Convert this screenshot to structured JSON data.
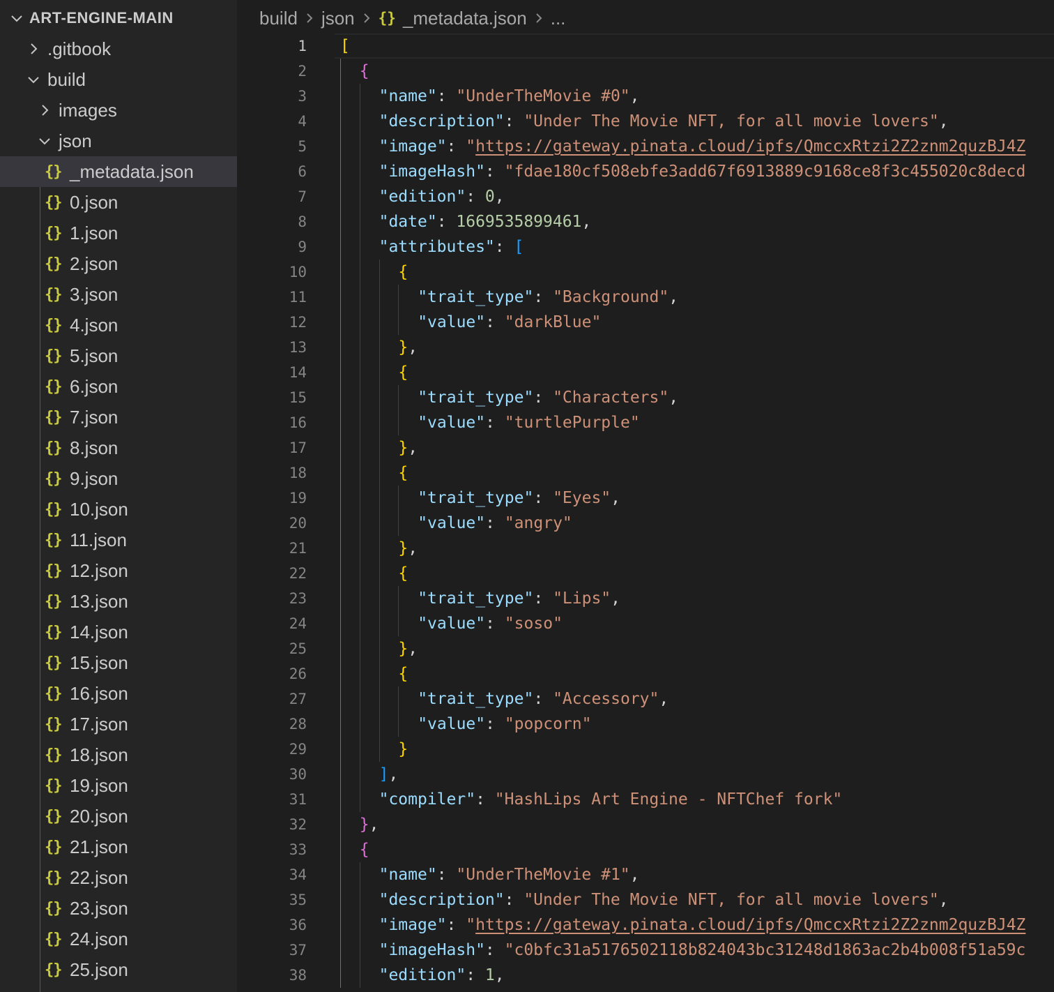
{
  "explorer": {
    "root_label": "ART-ENGINE-MAIN",
    "items": [
      {
        "label": ".gitbook",
        "type": "folder",
        "expanded": false,
        "depth": 1
      },
      {
        "label": "build",
        "type": "folder",
        "expanded": true,
        "depth": 1
      },
      {
        "label": "images",
        "type": "folder",
        "expanded": false,
        "depth": 2
      },
      {
        "label": "json",
        "type": "folder",
        "expanded": true,
        "depth": 2
      },
      {
        "label": "_metadata.json",
        "type": "file",
        "selected": true,
        "depth": 3
      },
      {
        "label": "0.json",
        "type": "file",
        "depth": 3
      },
      {
        "label": "1.json",
        "type": "file",
        "depth": 3
      },
      {
        "label": "2.json",
        "type": "file",
        "depth": 3
      },
      {
        "label": "3.json",
        "type": "file",
        "depth": 3
      },
      {
        "label": "4.json",
        "type": "file",
        "depth": 3
      },
      {
        "label": "5.json",
        "type": "file",
        "depth": 3
      },
      {
        "label": "6.json",
        "type": "file",
        "depth": 3
      },
      {
        "label": "7.json",
        "type": "file",
        "depth": 3
      },
      {
        "label": "8.json",
        "type": "file",
        "depth": 3
      },
      {
        "label": "9.json",
        "type": "file",
        "depth": 3
      },
      {
        "label": "10.json",
        "type": "file",
        "depth": 3
      },
      {
        "label": "11.json",
        "type": "file",
        "depth": 3
      },
      {
        "label": "12.json",
        "type": "file",
        "depth": 3
      },
      {
        "label": "13.json",
        "type": "file",
        "depth": 3
      },
      {
        "label": "14.json",
        "type": "file",
        "depth": 3
      },
      {
        "label": "15.json",
        "type": "file",
        "depth": 3
      },
      {
        "label": "16.json",
        "type": "file",
        "depth": 3
      },
      {
        "label": "17.json",
        "type": "file",
        "depth": 3
      },
      {
        "label": "18.json",
        "type": "file",
        "depth": 3
      },
      {
        "label": "19.json",
        "type": "file",
        "depth": 3
      },
      {
        "label": "20.json",
        "type": "file",
        "depth": 3
      },
      {
        "label": "21.json",
        "type": "file",
        "depth": 3
      },
      {
        "label": "22.json",
        "type": "file",
        "depth": 3
      },
      {
        "label": "23.json",
        "type": "file",
        "depth": 3
      },
      {
        "label": "24.json",
        "type": "file",
        "depth": 3
      },
      {
        "label": "25.json",
        "type": "file",
        "depth": 3
      }
    ],
    "file_icon_glyph": "{}"
  },
  "breadcrumb": {
    "items": [
      "build",
      "json",
      "_metadata.json",
      "..."
    ],
    "file_icon_glyph": "{}"
  },
  "editor": {
    "active_line": 1,
    "lines": [
      {
        "n": "1",
        "indent": 0,
        "tokens": [
          {
            "t": "[",
            "c": "b1"
          }
        ]
      },
      {
        "n": "2",
        "indent": 1,
        "tokens": [
          {
            "t": "{",
            "c": "b2"
          }
        ]
      },
      {
        "n": "3",
        "indent": 2,
        "tokens": [
          {
            "t": "\"name\"",
            "c": "k"
          },
          {
            "t": ": ",
            "c": "p"
          },
          {
            "t": "\"UnderTheMovie #0\"",
            "c": "s"
          },
          {
            "t": ",",
            "c": "p"
          }
        ]
      },
      {
        "n": "4",
        "indent": 2,
        "tokens": [
          {
            "t": "\"description\"",
            "c": "k"
          },
          {
            "t": ": ",
            "c": "p"
          },
          {
            "t": "\"Under The Movie NFT, for all movie lovers\"",
            "c": "s"
          },
          {
            "t": ",",
            "c": "p"
          }
        ]
      },
      {
        "n": "5",
        "indent": 2,
        "tokens": [
          {
            "t": "\"image\"",
            "c": "k"
          },
          {
            "t": ": ",
            "c": "p"
          },
          {
            "t": "\"",
            "c": "s"
          },
          {
            "t": "https://gateway.pinata.cloud/ipfs/QmccxRtzi2Z2znm2quzBJ4Z",
            "c": "u"
          }
        ]
      },
      {
        "n": "6",
        "indent": 2,
        "tokens": [
          {
            "t": "\"imageHash\"",
            "c": "k"
          },
          {
            "t": ": ",
            "c": "p"
          },
          {
            "t": "\"fdae180cf508ebfe3add67f6913889c9168ce8f3c455020c8decd",
            "c": "s"
          }
        ]
      },
      {
        "n": "7",
        "indent": 2,
        "tokens": [
          {
            "t": "\"edition\"",
            "c": "k"
          },
          {
            "t": ": ",
            "c": "p"
          },
          {
            "t": "0",
            "c": "n"
          },
          {
            "t": ",",
            "c": "p"
          }
        ]
      },
      {
        "n": "8",
        "indent": 2,
        "tokens": [
          {
            "t": "\"date\"",
            "c": "k"
          },
          {
            "t": ": ",
            "c": "p"
          },
          {
            "t": "1669535899461",
            "c": "n"
          },
          {
            "t": ",",
            "c": "p"
          }
        ]
      },
      {
        "n": "9",
        "indent": 2,
        "tokens": [
          {
            "t": "\"attributes\"",
            "c": "k"
          },
          {
            "t": ": ",
            "c": "p"
          },
          {
            "t": "[",
            "c": "b3"
          }
        ]
      },
      {
        "n": "10",
        "indent": 3,
        "tokens": [
          {
            "t": "{",
            "c": "b1"
          }
        ]
      },
      {
        "n": "11",
        "indent": 4,
        "tokens": [
          {
            "t": "\"trait_type\"",
            "c": "k"
          },
          {
            "t": ": ",
            "c": "p"
          },
          {
            "t": "\"Background\"",
            "c": "s"
          },
          {
            "t": ",",
            "c": "p"
          }
        ]
      },
      {
        "n": "12",
        "indent": 4,
        "tokens": [
          {
            "t": "\"value\"",
            "c": "k"
          },
          {
            "t": ": ",
            "c": "p"
          },
          {
            "t": "\"darkBlue\"",
            "c": "s"
          }
        ]
      },
      {
        "n": "13",
        "indent": 3,
        "tokens": [
          {
            "t": "}",
            "c": "b1"
          },
          {
            "t": ",",
            "c": "p"
          }
        ]
      },
      {
        "n": "14",
        "indent": 3,
        "tokens": [
          {
            "t": "{",
            "c": "b1"
          }
        ]
      },
      {
        "n": "15",
        "indent": 4,
        "tokens": [
          {
            "t": "\"trait_type\"",
            "c": "k"
          },
          {
            "t": ": ",
            "c": "p"
          },
          {
            "t": "\"Characters\"",
            "c": "s"
          },
          {
            "t": ",",
            "c": "p"
          }
        ]
      },
      {
        "n": "16",
        "indent": 4,
        "tokens": [
          {
            "t": "\"value\"",
            "c": "k"
          },
          {
            "t": ": ",
            "c": "p"
          },
          {
            "t": "\"turtlePurple\"",
            "c": "s"
          }
        ]
      },
      {
        "n": "17",
        "indent": 3,
        "tokens": [
          {
            "t": "}",
            "c": "b1"
          },
          {
            "t": ",",
            "c": "p"
          }
        ]
      },
      {
        "n": "18",
        "indent": 3,
        "tokens": [
          {
            "t": "{",
            "c": "b1"
          }
        ]
      },
      {
        "n": "19",
        "indent": 4,
        "tokens": [
          {
            "t": "\"trait_type\"",
            "c": "k"
          },
          {
            "t": ": ",
            "c": "p"
          },
          {
            "t": "\"Eyes\"",
            "c": "s"
          },
          {
            "t": ",",
            "c": "p"
          }
        ]
      },
      {
        "n": "20",
        "indent": 4,
        "tokens": [
          {
            "t": "\"value\"",
            "c": "k"
          },
          {
            "t": ": ",
            "c": "p"
          },
          {
            "t": "\"angry\"",
            "c": "s"
          }
        ]
      },
      {
        "n": "21",
        "indent": 3,
        "tokens": [
          {
            "t": "}",
            "c": "b1"
          },
          {
            "t": ",",
            "c": "p"
          }
        ]
      },
      {
        "n": "22",
        "indent": 3,
        "tokens": [
          {
            "t": "{",
            "c": "b1"
          }
        ]
      },
      {
        "n": "23",
        "indent": 4,
        "tokens": [
          {
            "t": "\"trait_type\"",
            "c": "k"
          },
          {
            "t": ": ",
            "c": "p"
          },
          {
            "t": "\"Lips\"",
            "c": "s"
          },
          {
            "t": ",",
            "c": "p"
          }
        ]
      },
      {
        "n": "24",
        "indent": 4,
        "tokens": [
          {
            "t": "\"value\"",
            "c": "k"
          },
          {
            "t": ": ",
            "c": "p"
          },
          {
            "t": "\"soso\"",
            "c": "s"
          }
        ]
      },
      {
        "n": "25",
        "indent": 3,
        "tokens": [
          {
            "t": "}",
            "c": "b1"
          },
          {
            "t": ",",
            "c": "p"
          }
        ]
      },
      {
        "n": "26",
        "indent": 3,
        "tokens": [
          {
            "t": "{",
            "c": "b1"
          }
        ]
      },
      {
        "n": "27",
        "indent": 4,
        "tokens": [
          {
            "t": "\"trait_type\"",
            "c": "k"
          },
          {
            "t": ": ",
            "c": "p"
          },
          {
            "t": "\"Accessory\"",
            "c": "s"
          },
          {
            "t": ",",
            "c": "p"
          }
        ]
      },
      {
        "n": "28",
        "indent": 4,
        "tokens": [
          {
            "t": "\"value\"",
            "c": "k"
          },
          {
            "t": ": ",
            "c": "p"
          },
          {
            "t": "\"popcorn\"",
            "c": "s"
          }
        ]
      },
      {
        "n": "29",
        "indent": 3,
        "tokens": [
          {
            "t": "}",
            "c": "b1"
          }
        ]
      },
      {
        "n": "30",
        "indent": 2,
        "tokens": [
          {
            "t": "]",
            "c": "b3"
          },
          {
            "t": ",",
            "c": "p"
          }
        ]
      },
      {
        "n": "31",
        "indent": 2,
        "tokens": [
          {
            "t": "\"compiler\"",
            "c": "k"
          },
          {
            "t": ": ",
            "c": "p"
          },
          {
            "t": "\"HashLips Art Engine - NFTChef fork\"",
            "c": "s"
          }
        ]
      },
      {
        "n": "32",
        "indent": 1,
        "tokens": [
          {
            "t": "}",
            "c": "b2"
          },
          {
            "t": ",",
            "c": "p"
          }
        ]
      },
      {
        "n": "33",
        "indent": 1,
        "tokens": [
          {
            "t": "{",
            "c": "b2"
          }
        ]
      },
      {
        "n": "34",
        "indent": 2,
        "tokens": [
          {
            "t": "\"name\"",
            "c": "k"
          },
          {
            "t": ": ",
            "c": "p"
          },
          {
            "t": "\"UnderTheMovie #1\"",
            "c": "s"
          },
          {
            "t": ",",
            "c": "p"
          }
        ]
      },
      {
        "n": "35",
        "indent": 2,
        "tokens": [
          {
            "t": "\"description\"",
            "c": "k"
          },
          {
            "t": ": ",
            "c": "p"
          },
          {
            "t": "\"Under The Movie NFT, for all movie lovers\"",
            "c": "s"
          },
          {
            "t": ",",
            "c": "p"
          }
        ]
      },
      {
        "n": "36",
        "indent": 2,
        "tokens": [
          {
            "t": "\"image\"",
            "c": "k"
          },
          {
            "t": ": ",
            "c": "p"
          },
          {
            "t": "\"",
            "c": "s"
          },
          {
            "t": "https://gateway.pinata.cloud/ipfs/QmccxRtzi2Z2znm2quzBJ4Z",
            "c": "u"
          }
        ]
      },
      {
        "n": "37",
        "indent": 2,
        "tokens": [
          {
            "t": "\"imageHash\"",
            "c": "k"
          },
          {
            "t": ": ",
            "c": "p"
          },
          {
            "t": "\"c0bfc31a5176502118b824043bc31248d1863ac2b4b008f51a59c",
            "c": "s"
          }
        ]
      },
      {
        "n": "38",
        "indent": 2,
        "tokens": [
          {
            "t": "\"edition\"",
            "c": "k"
          },
          {
            "t": ": ",
            "c": "p"
          },
          {
            "t": "1",
            "c": "n"
          },
          {
            "t": ",",
            "c": "p"
          }
        ]
      }
    ]
  }
}
